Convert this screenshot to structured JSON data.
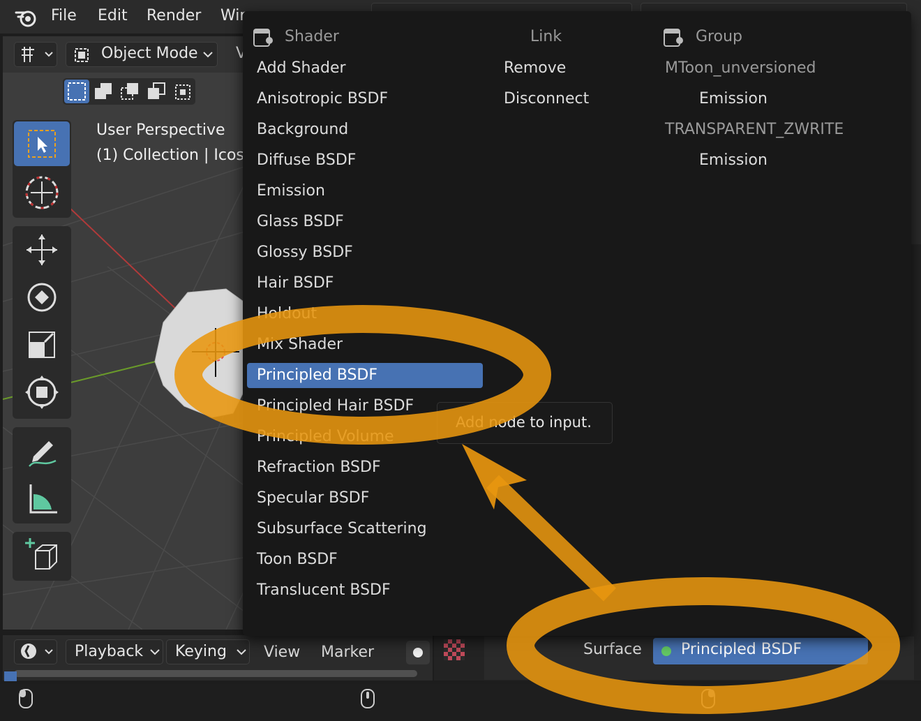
{
  "topbar": {
    "menus": [
      "File",
      "Edit",
      "Render",
      "Wir"
    ]
  },
  "viewport": {
    "mode_label": "Object Mode",
    "view_label": "V",
    "perspective_label": "User Perspective",
    "collection_label": "(1) Collection | Icosp"
  },
  "popup": {
    "shader": {
      "header": "Shader",
      "items": [
        "Add Shader",
        "Anisotropic BSDF",
        "Background",
        "Diffuse BSDF",
        "Emission",
        "Glass BSDF",
        "Glossy BSDF",
        "Hair BSDF",
        "Holdout",
        "Mix Shader",
        "Principled BSDF",
        "Principled Hair BSDF",
        "Principled Volume",
        "Refraction BSDF",
        "Specular BSDF",
        "Subsurface Scattering",
        "Toon BSDF",
        "Translucent BSDF"
      ],
      "highlighted": "Principled BSDF"
    },
    "link": {
      "header": "Link",
      "items": [
        "Remove",
        "Disconnect"
      ]
    },
    "group": {
      "header": "Group",
      "items": [
        {
          "label": "MToon_unversioned",
          "sub": false
        },
        {
          "label": "Emission",
          "sub": true
        },
        {
          "label": "TRANSPARENT_ZWRITE",
          "sub": false
        },
        {
          "label": "Emission",
          "sub": true
        }
      ]
    }
  },
  "tooltip": {
    "text": "Add node to input."
  },
  "timeline": {
    "items": [
      "Playback",
      "Keying",
      "View",
      "Marker"
    ]
  },
  "properties": {
    "surface_label": "Surface",
    "surface_value": "Principled BSDF"
  },
  "colors": {
    "accent": "#4772b3",
    "annotation": "#e8960f",
    "socket_green": "#63c763"
  },
  "icons": [
    "blender-logo-icon",
    "select-box-icon",
    "cursor-icon",
    "move-icon",
    "rotate-icon",
    "scale-icon",
    "transform-icon",
    "annotate-icon",
    "measure-icon",
    "add-cube-icon",
    "shader-node-icon",
    "group-node-icon",
    "checker-texture-icon",
    "mouse-icon"
  ]
}
